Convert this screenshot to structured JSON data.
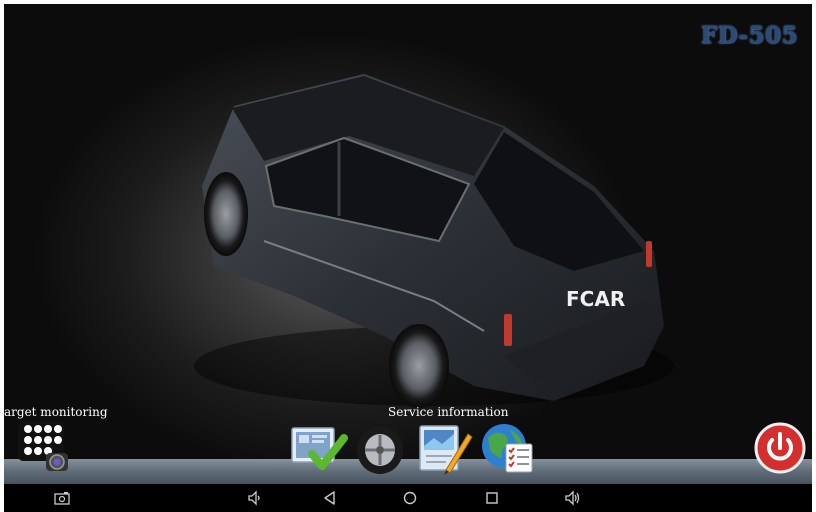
{
  "header": {
    "model_label": "FD-505"
  },
  "car": {
    "badge_text": "FCAR"
  },
  "dock": {
    "items": [
      {
        "name": "target-monitoring",
        "label": "arget monitoring",
        "icon": "camera-grid-icon"
      },
      {
        "name": "diagnosis",
        "label": "",
        "icon": "checklist-monitor-icon"
      },
      {
        "name": "tire",
        "label": "",
        "icon": "tire-icon"
      },
      {
        "name": "service-information",
        "label": "Service information",
        "icon": "document-pen-icon"
      },
      {
        "name": "web-report",
        "label": "",
        "icon": "globe-report-icon"
      },
      {
        "name": "power",
        "label": "",
        "icon": "power-icon"
      }
    ]
  },
  "navbar": {
    "buttons": [
      "screenshot-icon",
      "volume-down-icon",
      "back-icon",
      "home-icon",
      "recents-icon",
      "volume-up-icon"
    ]
  },
  "colors": {
    "model_label": "#2a4a78",
    "power_button": "#d32f2f",
    "navbar": "#000000"
  }
}
